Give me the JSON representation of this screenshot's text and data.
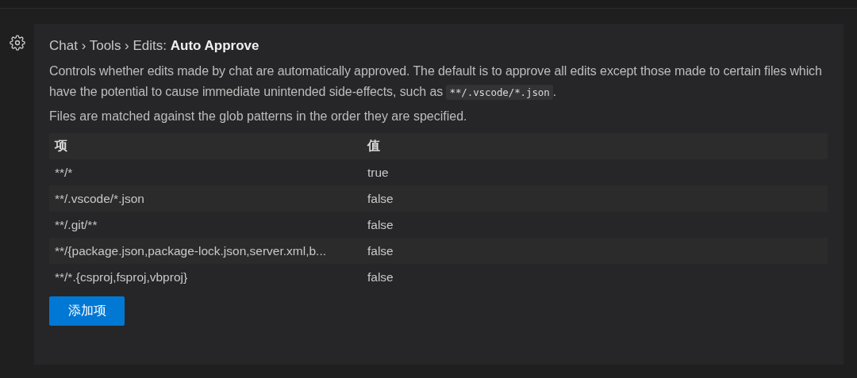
{
  "setting": {
    "title": "Chat › Tools › Edits: **Auto Approve**",
    "description": {
      "text": "Controls whether edits made by chat are automatically approved. The default is to approve all edits except those made to certain files which have the potential to cause immediate unintended side-effects, such as ",
      "code": "**/.vscode/*.json",
      "suffix": "."
    },
    "note": "Files are matched against the glob patterns in the order they are specified.",
    "table": {
      "columns": [
        "项",
        "值"
      ],
      "rows": [
        {
          "item": "**/*",
          "value": "true"
        },
        {
          "item": "**/.vscode/*.json",
          "value": "false"
        },
        {
          "item": "**/.git/**",
          "value": "false"
        },
        {
          "item": "**/{package.json,package-lock.json,server.xml,b...",
          "value": "false"
        },
        {
          "item": "**/*.{csproj,fsproj,vbproj}",
          "value": "false"
        }
      ]
    },
    "add_button": "添加项"
  }
}
